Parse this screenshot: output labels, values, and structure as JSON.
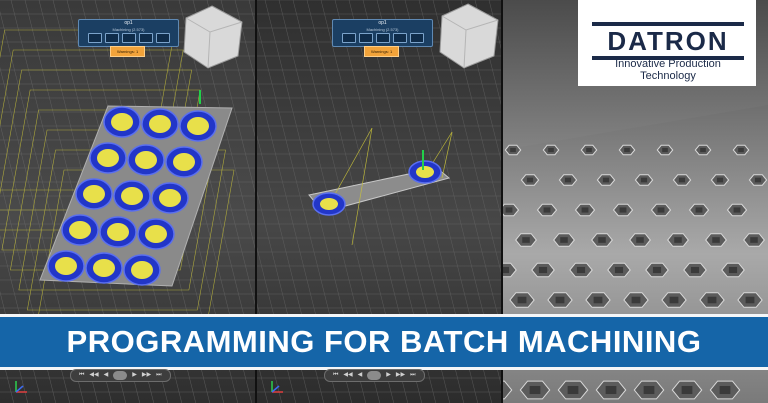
{
  "brand": {
    "name": "DATRON",
    "tagline": "Innovative Production Technology",
    "color": "#1b2a48"
  },
  "banner": {
    "text": "PROGRAMMING FOR BATCH MACHINING",
    "color": "#1565a8"
  },
  "panels": [
    {
      "toolbar": {
        "title": "op1",
        "subtitle": "Machining (2.573)",
        "warning_label": "Warnings: 1"
      },
      "player_controls": [
        "⏮",
        "◀◀",
        "◀",
        "▶",
        "▶▶",
        "⏭"
      ]
    },
    {
      "toolbar": {
        "title": "op1",
        "subtitle": "Machining (2.573)",
        "warning_label": "Warnings: 1"
      },
      "player_controls": [
        "⏮",
        "◀◀",
        "◀",
        "▶",
        "▶▶",
        "⏭"
      ]
    }
  ],
  "icons": [
    "view-cube-icon",
    "axis-triad-icon",
    "toolpath-icon",
    "fixture-icon",
    "workpiece-icon",
    "warning-icon",
    "play-icon",
    "rewind-icon",
    "fast-forward-icon"
  ],
  "colors": {
    "toolpath_blue": "#2236c8",
    "toolpath_yellow": "#e8e04a",
    "fixture_lines": "#c8c23a",
    "warning": "#f2a33a"
  }
}
